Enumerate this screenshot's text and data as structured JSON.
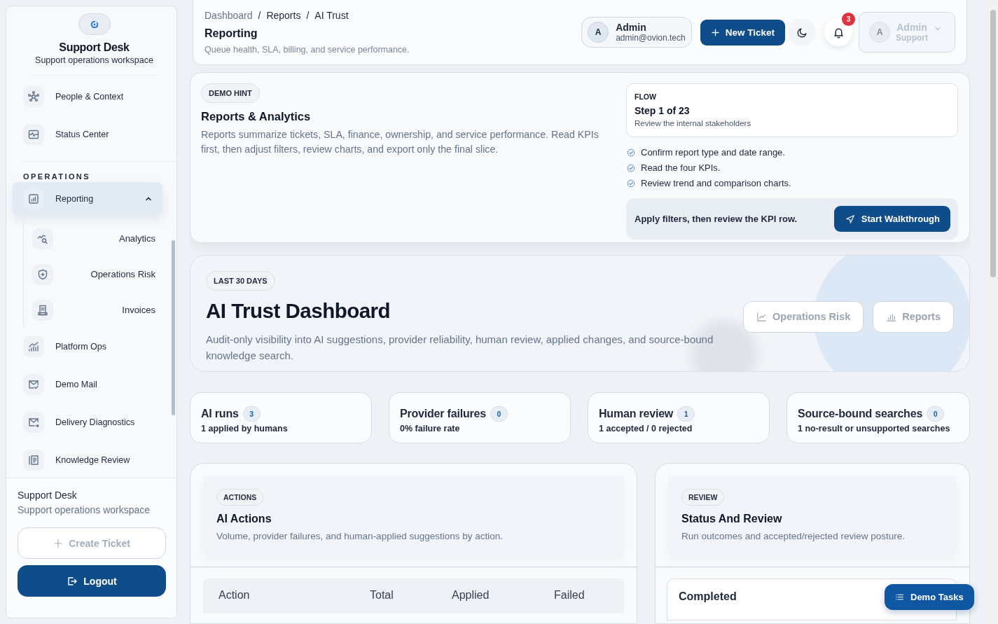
{
  "sidebar": {
    "brand_title": "Support Desk",
    "brand_subtitle": "Support operations workspace",
    "items": [
      {
        "label": "People & Context",
        "selected": false
      },
      {
        "label": "Status Center",
        "selected": false
      }
    ],
    "section_title": "OPERATIONS",
    "section_items": [
      {
        "label": "Reporting",
        "selected": true,
        "expanded": true,
        "children": [
          {
            "label": "Analytics",
            "selected": false
          },
          {
            "label": "Operations Risk",
            "selected": false
          },
          {
            "label": "Invoices",
            "selected": false
          }
        ]
      },
      {
        "label": "Platform Ops",
        "selected": false
      },
      {
        "label": "Demo Mail",
        "selected": false
      },
      {
        "label": "Delivery Diagnostics",
        "selected": false
      },
      {
        "label": "Knowledge Review",
        "selected": false
      }
    ],
    "footer": {
      "title": "Support Desk",
      "subtitle": "Support operations workspace",
      "buttons": [
        {
          "label": "Create Ticket",
          "kind": "outline",
          "disabled": true
        },
        {
          "label": "Logout",
          "kind": "primary",
          "disabled": false
        }
      ]
    }
  },
  "header": {
    "breadcrumbs": [
      "Dashboard",
      "Reports",
      "AI Trust"
    ],
    "breadcrumb_separator": "/",
    "title": "Reporting",
    "subtitle": "Queue health, SLA, billing, and service performance.",
    "user": {
      "initial": "A",
      "name": "Admin",
      "email": "admin@ovion.tech"
    },
    "new_ticket": "New Ticket",
    "notification_count": "3",
    "account": {
      "initial": "A",
      "name": "Admin",
      "role": "Support",
      "disabled": true
    }
  },
  "hint": {
    "badge": "DEMO HINT",
    "title": "Reports & Analytics",
    "text": "Reports summarize tickets, SLA, finance, ownership, and service performance. Read KPIs first, then adjust filters, review charts, and export only the final slice.",
    "flow": {
      "label": "FLOW",
      "step": "Step 1 of 23",
      "subtitle": "Review the internal stakeholders"
    },
    "checklist": [
      {
        "text": "Confirm report type and date range.",
        "checked": true
      },
      {
        "text": "Read the four KPIs.",
        "checked": true
      },
      {
        "text": "Review trend and comparison charts.",
        "checked": true
      }
    ],
    "footer_text": "Apply filters, then review the KPI row.",
    "button": "Start Walkthrough"
  },
  "hero": {
    "badge": "LAST 30 DAYS",
    "title": "AI Trust Dashboard",
    "text": "Audit-only visibility into AI suggestions, provider reliability, human review, applied changes, and source-bound knowledge search.",
    "buttons": [
      "Operations Risk",
      "Reports"
    ]
  },
  "kpis": [
    {
      "title": "AI runs",
      "count": "3",
      "sub": "1 applied by humans"
    },
    {
      "title": "Provider failures",
      "count": "0",
      "sub": "0% failure rate"
    },
    {
      "title": "Human review",
      "count": "1",
      "sub": "1 accepted / 0 rejected"
    },
    {
      "title": "Source-bound searches",
      "count": "0",
      "sub": "1 no-result or unsupported searches"
    }
  ],
  "actions_panel": {
    "badge": "ACTIONS",
    "title": "AI Actions",
    "text": "Volume, provider failures, and human-applied suggestions by action.",
    "table": {
      "columns": [
        "Action",
        "Total",
        "Applied",
        "Failed"
      ]
    }
  },
  "review_panel": {
    "badge": "REVIEW",
    "title": "Status And Review",
    "text": "Run outcomes and accepted/rejected review posture.",
    "cards": [
      "Completed"
    ]
  },
  "floating_button": "Demo Tasks"
}
